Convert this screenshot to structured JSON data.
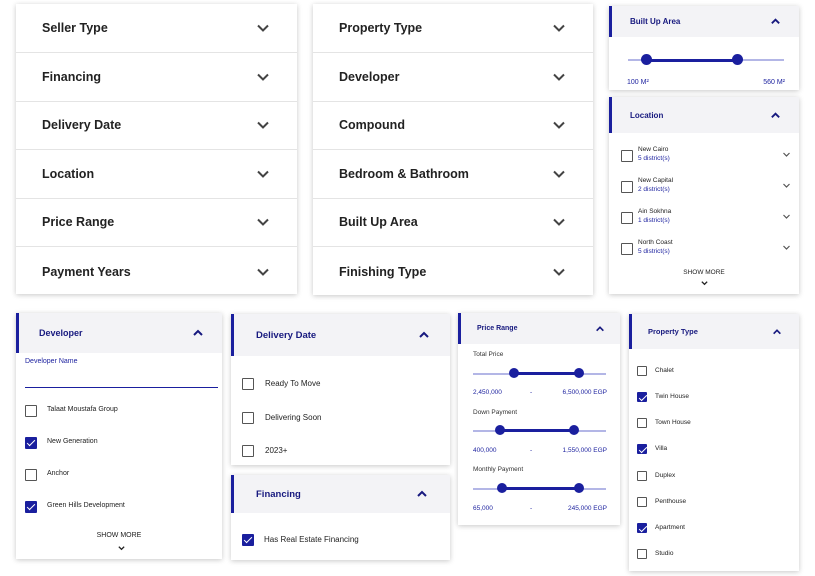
{
  "accent_color": "#1a1f9e",
  "panel_a": {
    "items": [
      {
        "label": "Seller Type"
      },
      {
        "label": "Financing"
      },
      {
        "label": "Delivery Date"
      },
      {
        "label": "Location"
      },
      {
        "label": "Price Range"
      },
      {
        "label": "Payment Years"
      }
    ]
  },
  "panel_b": {
    "items": [
      {
        "label": "Property Type"
      },
      {
        "label": "Developer"
      },
      {
        "label": "Compound"
      },
      {
        "label": "Bedroom & Bathroom"
      },
      {
        "label": "Built Up Area"
      },
      {
        "label": "Finishing Type"
      }
    ]
  },
  "built_up_area": {
    "title": "Built Up Area",
    "min_label": "100 M²",
    "max_label": "560 M²",
    "low_fraction": 0.12,
    "high_fraction": 0.7
  },
  "location": {
    "title": "Location",
    "items": [
      {
        "name": "New Cairo",
        "sub": "5 district(s)",
        "checked": false
      },
      {
        "name": "New Capital",
        "sub": "2 district(s)",
        "checked": false
      },
      {
        "name": "Ain Sokhna",
        "sub": "1 district(s)",
        "checked": false
      },
      {
        "name": "North Coast",
        "sub": "5 district(s)",
        "checked": false
      }
    ],
    "show_more": "SHOW MORE"
  },
  "developer": {
    "title": "Developer",
    "field_label": "Developer Name",
    "field_value": "",
    "items": [
      {
        "name": "Talaat Moustafa Group",
        "checked": false
      },
      {
        "name": "New Generation",
        "checked": true
      },
      {
        "name": "Anchor",
        "checked": false
      },
      {
        "name": "Green Hills Development",
        "checked": true
      }
    ],
    "show_more": "SHOW MORE"
  },
  "delivery_date": {
    "title": "Delivery Date",
    "items": [
      {
        "name": "Ready To Move",
        "checked": false
      },
      {
        "name": "Delivering Soon",
        "checked": false
      },
      {
        "name": "2023+",
        "checked": false
      }
    ]
  },
  "financing": {
    "title": "Financing",
    "items": [
      {
        "name": "Has Real Estate Financing",
        "checked": true
      }
    ]
  },
  "price_range": {
    "title": "Price Range",
    "sliders": [
      {
        "label": "Total Price",
        "min": "2,450,000",
        "sep": "-",
        "max": "6,500,000 EGP",
        "low_fraction": 0.31,
        "high_fraction": 0.8
      },
      {
        "label": "Down Payment",
        "min": "400,000",
        "sep": "-",
        "max": "1,550,000 EGP",
        "low_fraction": 0.2,
        "high_fraction": 0.76
      },
      {
        "label": "Monthly Payment",
        "min": "65,000",
        "sep": "-",
        "max": "245,000 EGP",
        "low_fraction": 0.22,
        "high_fraction": 0.8
      }
    ]
  },
  "property_type": {
    "title": "Property Type",
    "items": [
      {
        "name": "Chalet",
        "checked": false
      },
      {
        "name": "Twin House",
        "checked": true
      },
      {
        "name": "Town House",
        "checked": false
      },
      {
        "name": "Villa",
        "checked": true
      },
      {
        "name": "Duplex",
        "checked": false
      },
      {
        "name": "Penthouse",
        "checked": false
      },
      {
        "name": "Apartment",
        "checked": true
      },
      {
        "name": "Studio",
        "checked": false
      }
    ]
  }
}
